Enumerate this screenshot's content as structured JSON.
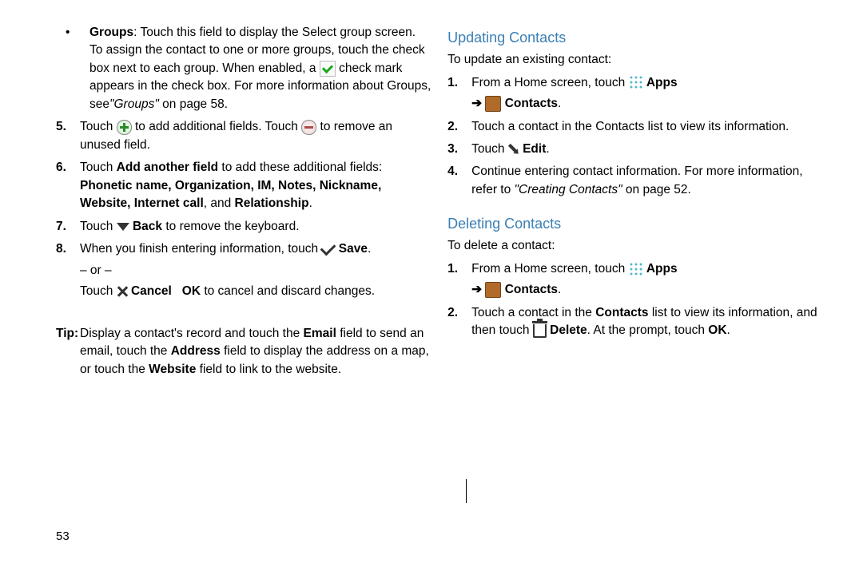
{
  "left": {
    "bullet_groups_label": "Groups",
    "bullet_groups_text1": ": Touch this field to display the Select group screen. To assign the contact to one or more groups, touch the check box next to each group. When enabled, a ",
    "bullet_groups_text2": " check mark appears in the check box. For more information about Groups, see",
    "bullet_groups_ref": "\"Groups\"",
    "bullet_groups_ref_tail": " on page 58.",
    "step5_a": "Touch ",
    "step5_b": " to add additional fields. Touch ",
    "step5_c": " to remove an unused field.",
    "step6_a": "Touch ",
    "step6_bold_add": "Add another field",
    "step6_b": " to add these additional fields: ",
    "step6_bold_fields": "Phonetic name, Organization, IM, Notes, Nickname, Website, Internet call",
    "step6_c": ", and ",
    "step6_bold_rel": "Relationship",
    "step6_d": ".",
    "step7_a": "Touch ",
    "step7_bold_back": "Back",
    "step7_b": " to remove the keyboard.",
    "step8_a": "When you finish entering information, touch ",
    "step8_bold_save": "Save",
    "step8_b": ".",
    "step8_or": "– or –",
    "step8_c": "Touch ",
    "step8_bold_cancel": "Cancel",
    "step8_d": " ",
    "step8_bold_ok": "OK",
    "step8_e": " to cancel and discard changes.",
    "tip_label": "Tip:",
    "tip_a": " Display a contact's record and touch the ",
    "tip_bold_email": "Email",
    "tip_b": " field to send an email, touch the ",
    "tip_bold_address": "Address",
    "tip_c": " field to display the address on a map, or touch the ",
    "tip_bold_website": "Website",
    "tip_d": " field to link to the website.",
    "page_number": "53"
  },
  "right": {
    "h_updating": "Updating Contacts",
    "upd_intro": "To update an existing contact:",
    "upd1_a": "From a Home screen, touch ",
    "upd1_apps": "Apps",
    "upd1_arrow": " ➔ ",
    "upd1_contacts": "Contacts",
    "upd1_c": ".",
    "upd2": "Touch a contact in the Contacts list to view its information.",
    "upd3_a": "Touch ",
    "upd3_edit": "Edit",
    "upd3_b": ".",
    "upd4_a": "Continue entering contact information. For more information, refer to ",
    "upd4_ref": "\"Creating Contacts\"",
    "upd4_b": " on page 52.",
    "h_deleting": "Deleting Contacts",
    "del_intro": "To delete a contact:",
    "del1_a": "From a Home screen, touch ",
    "del1_apps": "Apps",
    "del1_arrow": " ➔ ",
    "del1_contacts": "Contacts",
    "del1_c": ".",
    "del2_a": "Touch a contact in the ",
    "del2_bold_contacts": "Contacts",
    "del2_b": " list to view its information, and then touch ",
    "del2_bold_delete": "Delete",
    "del2_c": ". At the prompt, touch ",
    "del2_bold_ok": "OK",
    "del2_d": "."
  },
  "numbers": {
    "n5": "5.",
    "n6": "6.",
    "n7": "7.",
    "n8": "8.",
    "n1": "1.",
    "n2": "2.",
    "n3": "3.",
    "n4": "4."
  }
}
